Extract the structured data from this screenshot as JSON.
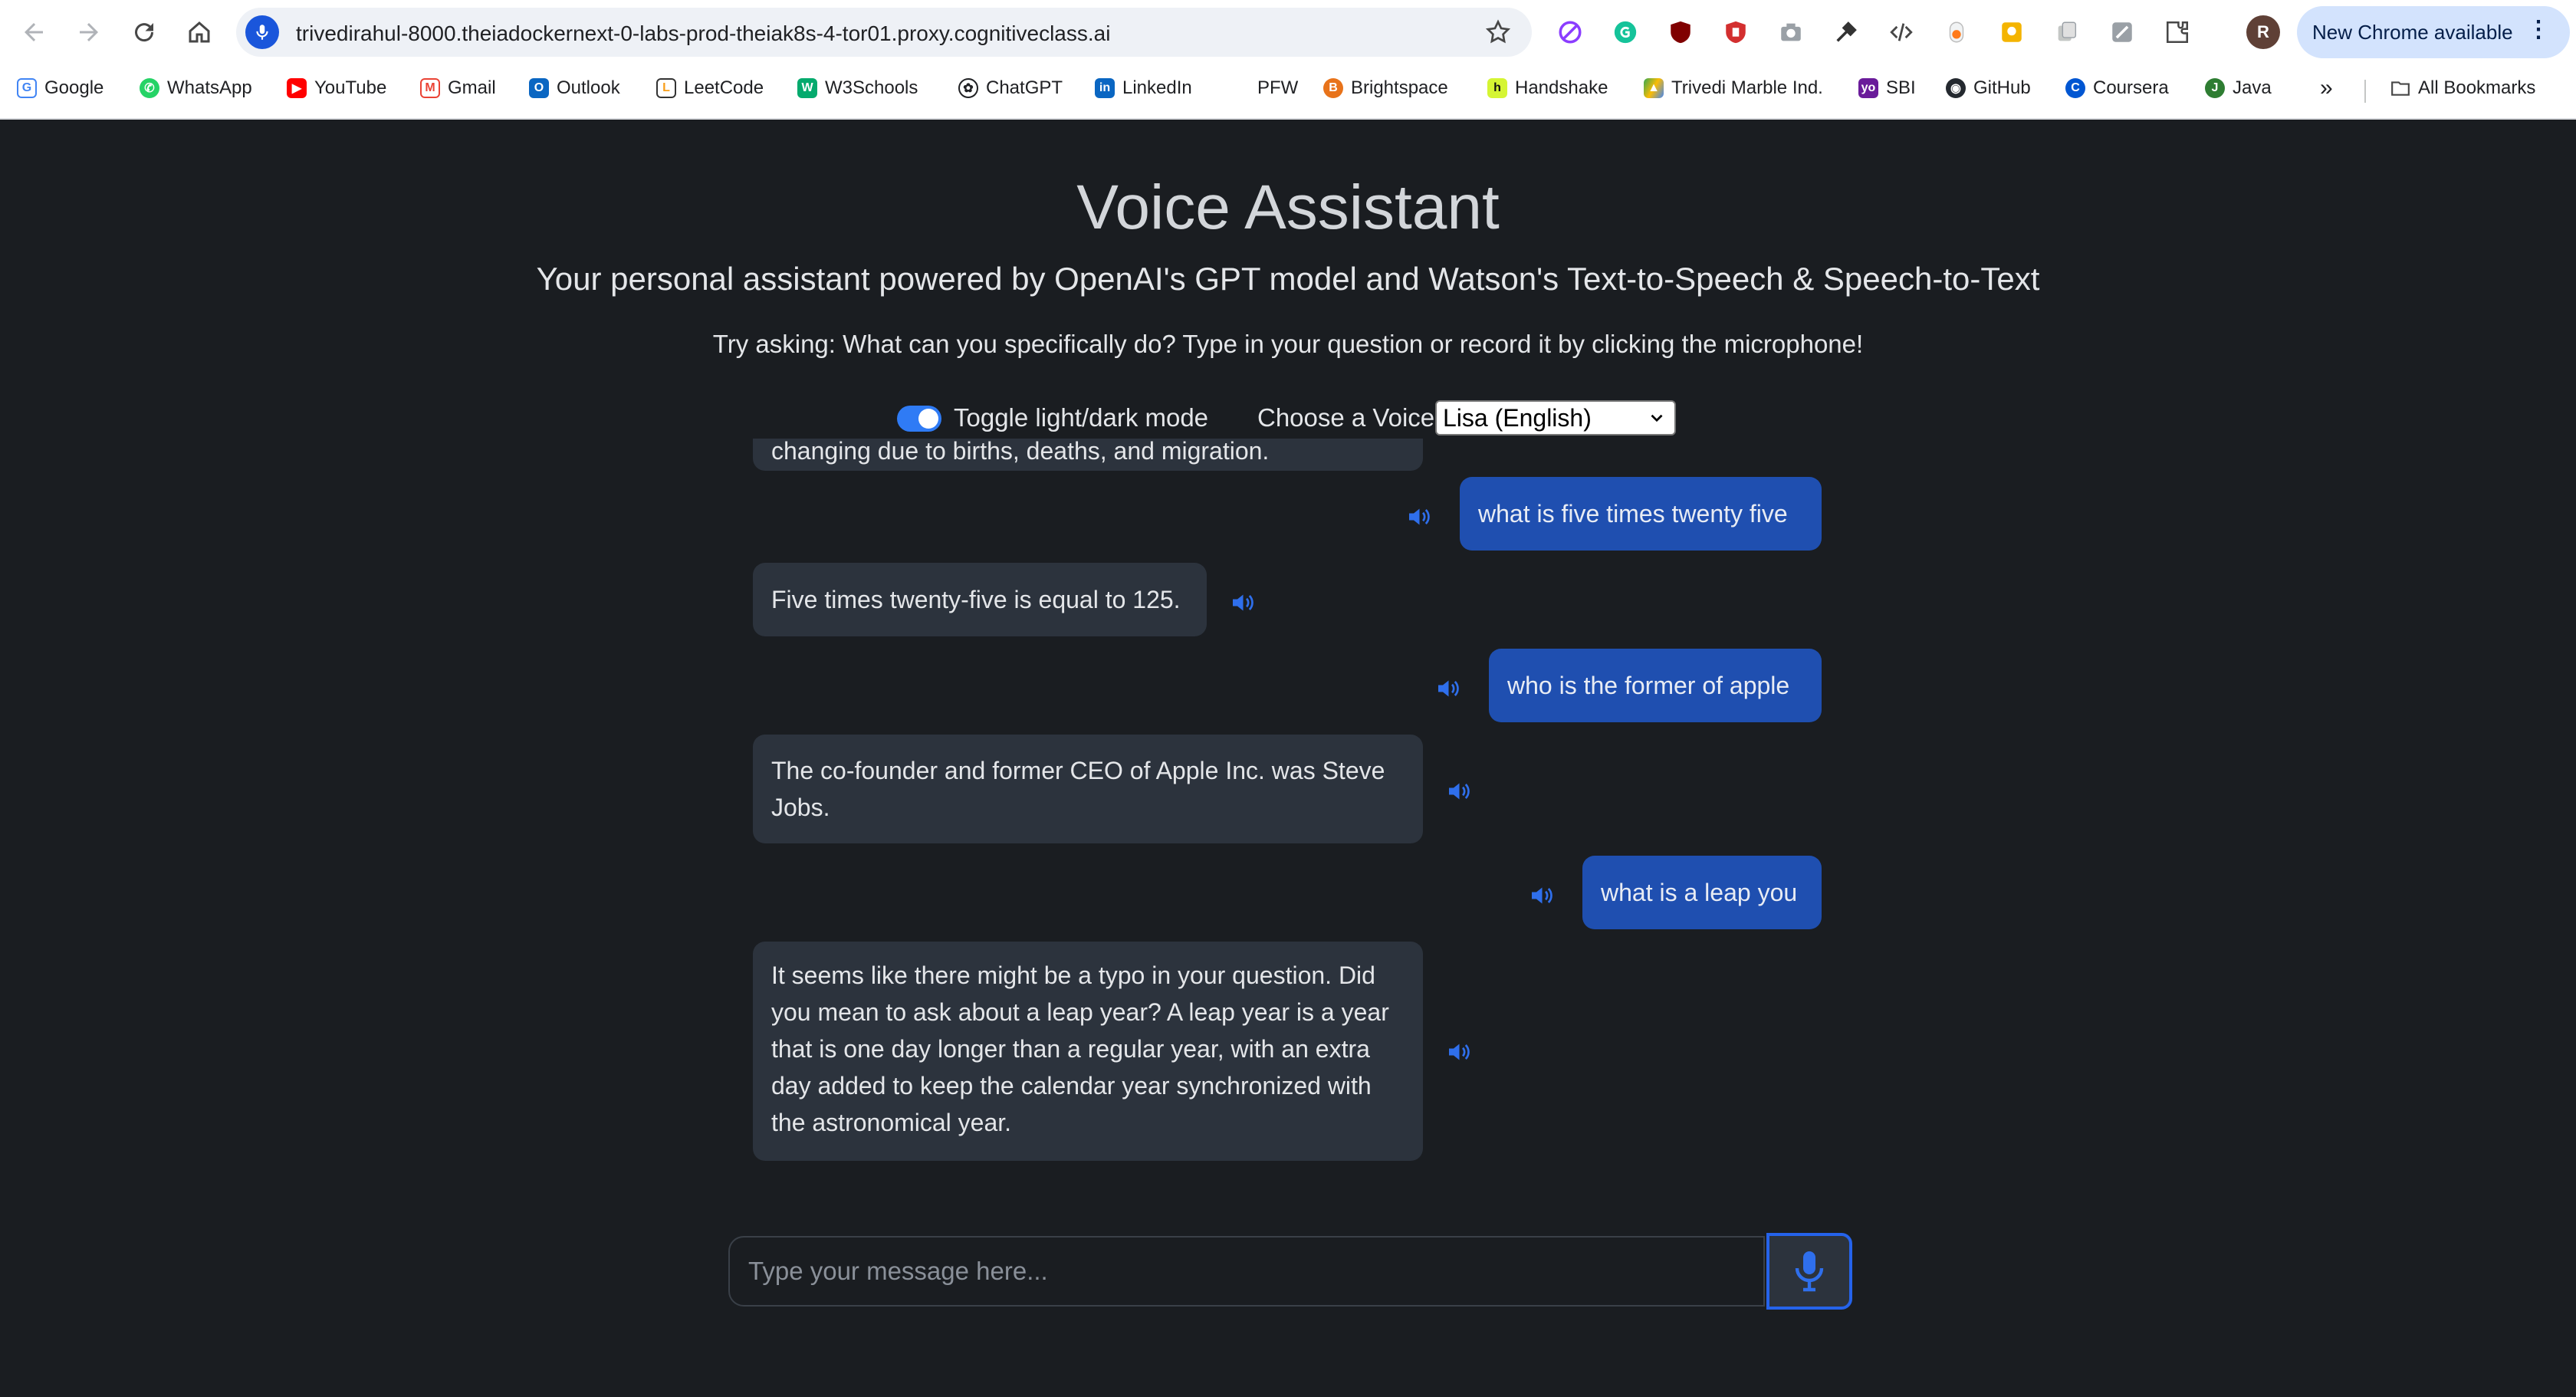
{
  "browser": {
    "url": "trivedirahul-8000.theiadockernext-0-labs-prod-theiak8s-4-tor01.proxy.cognitiveclass.ai",
    "update_label": "New Chrome available",
    "avatar_letter": "R",
    "bookmarks": [
      {
        "label": "Google",
        "icon": "google-icon",
        "color": "#4285f4"
      },
      {
        "label": "WhatsApp",
        "icon": "whatsapp-icon",
        "color": "#25d366"
      },
      {
        "label": "YouTube",
        "icon": "youtube-icon",
        "color": "#ff0000"
      },
      {
        "label": "Gmail",
        "icon": "gmail-icon",
        "color": "#ea4335"
      },
      {
        "label": "Outlook",
        "icon": "outlook-icon",
        "color": "#0a66c2"
      },
      {
        "label": "LeetCode",
        "icon": "leetcode-icon",
        "color": "#f89f1b"
      },
      {
        "label": "W3Schools",
        "icon": "w3schools-icon",
        "color": "#04aa6d"
      },
      {
        "label": "ChatGPT",
        "icon": "chatgpt-icon",
        "color": "#202124"
      },
      {
        "label": "LinkedIn",
        "icon": "linkedin-icon",
        "color": "#0a66c2"
      },
      {
        "label": "PFW",
        "icon": "",
        "color": ""
      },
      {
        "label": "Brightspace",
        "icon": "brightspace-icon",
        "color": "#e8731a"
      },
      {
        "label": "Handshake",
        "icon": "handshake-icon",
        "color": "#d5f533"
      },
      {
        "label": "Trivedi Marble Ind.",
        "icon": "drive-icon",
        "color": "#34a853"
      },
      {
        "label": "SBI",
        "icon": "sbi-icon",
        "color": "#6a1b9a"
      },
      {
        "label": "GitHub",
        "icon": "github-icon",
        "color": "#24292f"
      },
      {
        "label": "Coursera",
        "icon": "coursera-icon",
        "color": "#0056d2"
      },
      {
        "label": "Java",
        "icon": "java-icon",
        "color": "#2e7d32"
      }
    ],
    "all_bookmarks_label": "All Bookmarks",
    "overflow_label": "»"
  },
  "page": {
    "title": "Voice Assistant",
    "subtitle": "Your personal assistant powered by OpenAI's GPT model and Watson's Text-to-Speech & Speech-to-Text",
    "hint": "Try asking: What can you specifically do? Type in your question or record it by clicking the microphone!",
    "toggle_label": "Toggle light/dark mode",
    "toggle_on": true,
    "voice_label": "Choose a Voice",
    "voice_selected": "Lisa (English)",
    "input_placeholder": "Type your message here...",
    "accent_color": "#2563eb"
  },
  "chat": {
    "partial_top": "changing due to births, deaths, and migration.",
    "messages": [
      {
        "role": "user",
        "text": "what is five times twenty five"
      },
      {
        "role": "bot",
        "text": "Five times twenty-five is equal to 125."
      },
      {
        "role": "user",
        "text": "who is the former of apple"
      },
      {
        "role": "bot",
        "text": "The co-founder and former CEO of Apple Inc. was Steve Jobs."
      },
      {
        "role": "user",
        "text": "what is a leap you"
      },
      {
        "role": "bot",
        "text": "It seems like there might be a typo in your question. Did you mean to ask about a leap year? A leap year is a year that is one day longer than a regular year, with an extra day added to keep the calendar year synchronized with the astronomical year."
      }
    ]
  }
}
